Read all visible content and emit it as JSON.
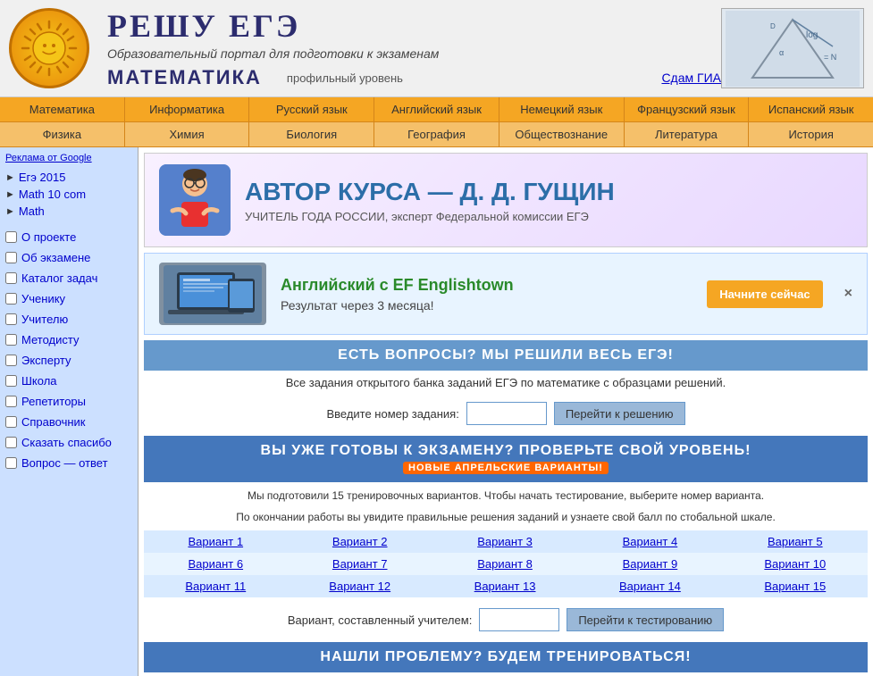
{
  "header": {
    "title": "РЕШУ ЕГЭ",
    "subtitle": "Образовательный портал для подготовки к экзаменам",
    "math_title": "МАТЕМАТИКА",
    "math_level": "профильный уровень",
    "gia_link": "Сдам ГИА"
  },
  "nav1": {
    "items": [
      "Математика",
      "Информатика",
      "Русский язык",
      "Английский язык",
      "Немецкий язык",
      "Французский язык",
      "Испанский язык"
    ]
  },
  "nav2": {
    "items": [
      "Физика",
      "Химия",
      "Биология",
      "География",
      "Обществознание",
      "Литература",
      "История"
    ]
  },
  "sidebar": {
    "ad_label": "Реклама от Google",
    "links": [
      {
        "label": "Егэ 2015",
        "arrow": "►"
      },
      {
        "label": "Math 10 com",
        "arrow": "►"
      },
      {
        "label": "Math",
        "arrow": "►"
      }
    ],
    "menu": [
      "О проекте",
      "Об экзамене",
      "Каталог задач",
      "Ученику",
      "Учителю",
      "Методисту",
      "Эксперту",
      "Школа",
      "Репетиторы",
      "Справочник",
      "Сказать спасибо",
      "Вопрос — ответ"
    ]
  },
  "author": {
    "label": "АВТОР КУРСА — Д. Д. ГУЩИН",
    "desc": "УЧИТЕЛЬ ГОДА РОССИИ, эксперт Федеральной комиссии ЕГЭ"
  },
  "ad": {
    "title": "Английский с EF Englishtown",
    "subtitle": "Результат через 3 месяца!",
    "btn": "Начните сейчас",
    "close": "×"
  },
  "questions_section": {
    "header": "ЕСТЬ ВОПРОСЫ? МЫ РЕШИЛИ ВЕСЬ ЕГЭ!",
    "text": "Все задания открытого банка заданий ЕГЭ по математике с образцами решений.",
    "input_label": "Введите номер задания:",
    "input_placeholder": "",
    "btn": "Перейти к решению"
  },
  "exam_section": {
    "header": "ВЫ УЖЕ ГОТОВЫ К ЭКЗАМЕНУ? ПРОВЕРЬТЕ СВОЙ УРОВЕНЬ!",
    "badge": "Новые апрельские варианты!",
    "text1": "Мы подготовили 15 тренировочных вариантов. Чтобы начать тестирование, выберите номер варианта.",
    "text2": "По окончании работы вы увидите правильные решения заданий и узнаете свой балл по стобальной шкале.",
    "variants": [
      [
        "Вариант 1",
        "Вариант 2",
        "Вариант 3",
        "Вариант 4",
        "Вариант 5"
      ],
      [
        "Вариант 6",
        "Вариант 7",
        "Вариант 8",
        "Вариант 9",
        "Вариант 10"
      ],
      [
        "Вариант 11",
        "Вариант 12",
        "Вариант 13",
        "Вариант 14",
        "Вариант 15"
      ]
    ],
    "teacher_label": "Вариант, составленный учителем:",
    "teacher_btn": "Перейти к тестированию"
  },
  "problem_section": {
    "header": "НАШЛИ ПРОБЛЕМУ? БУДЕМ ТРЕНИРОВАТЬСЯ!"
  },
  "colors": {
    "nav1_bg": "#f5a623",
    "nav2_bg": "#f5c06a",
    "section_header": "#6699cc",
    "section_header2": "#4477bb"
  }
}
